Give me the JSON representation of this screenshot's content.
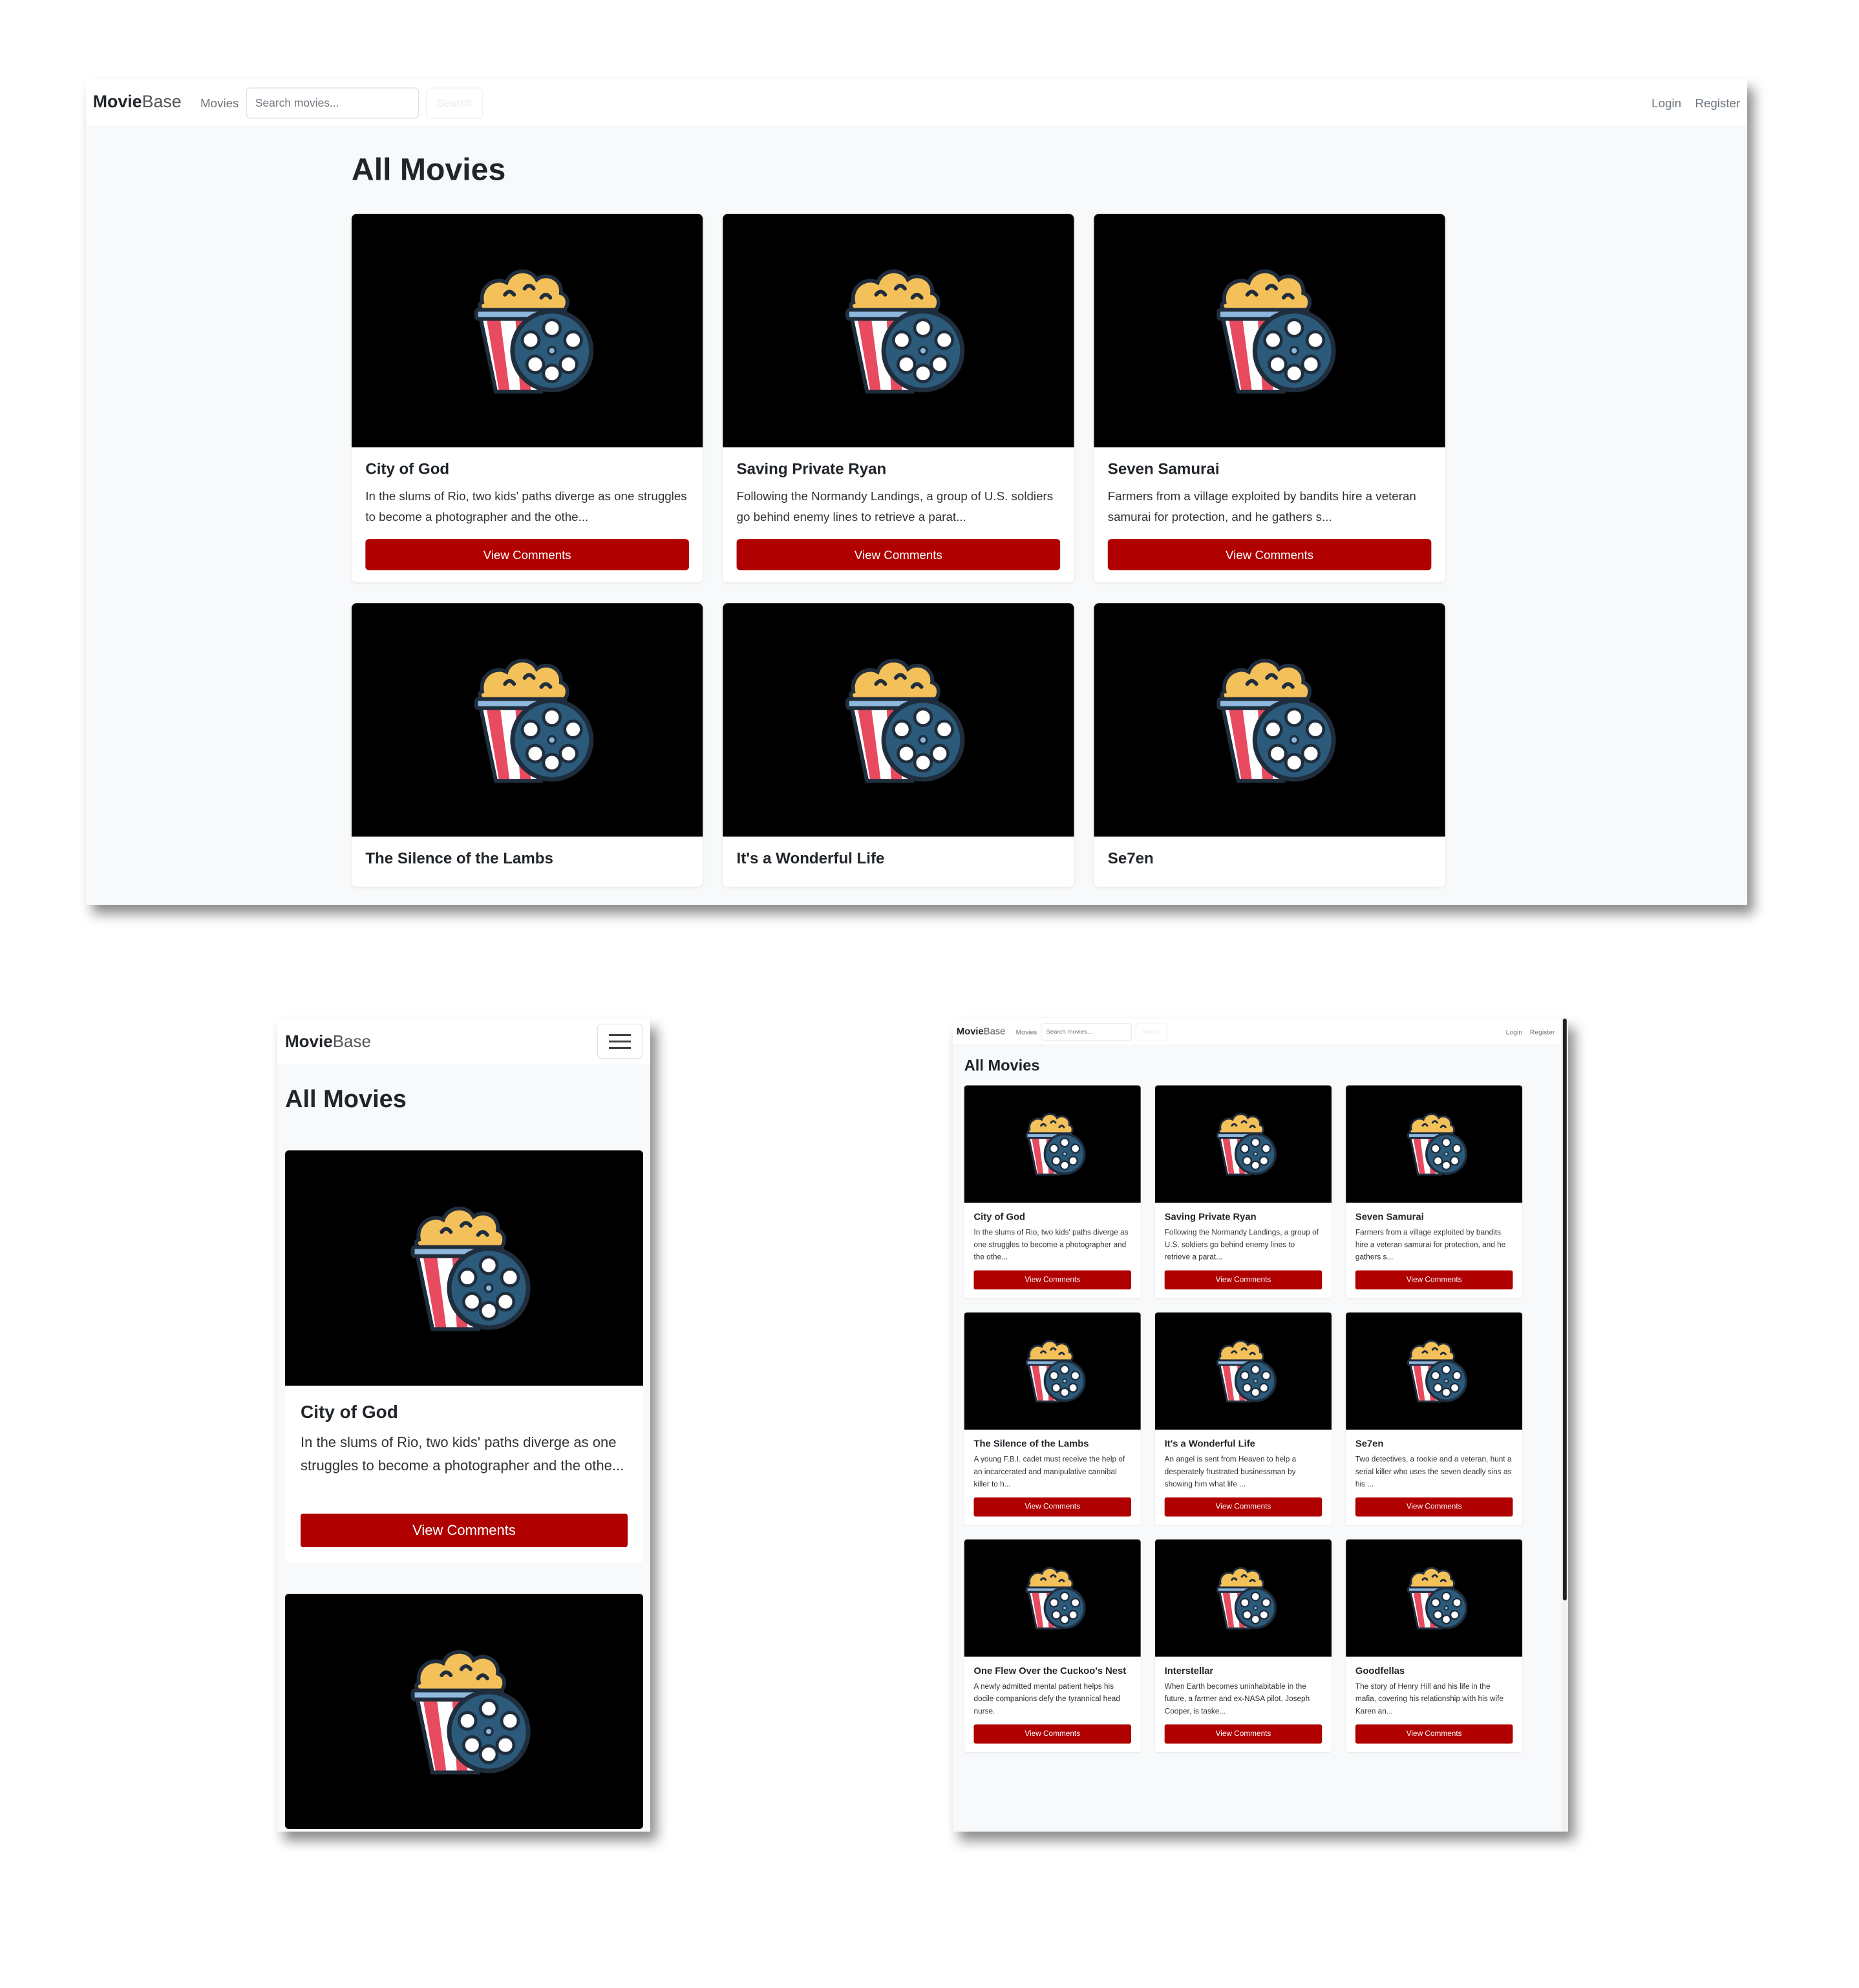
{
  "brand": {
    "bold": "Movie",
    "light": "Base"
  },
  "nav": {
    "movies": "Movies",
    "search_placeholder": "Search movies...",
    "search_button": "Search",
    "login": "Login",
    "register": "Register"
  },
  "page_title": "All Movies",
  "button_label": "View Comments",
  "movies": [
    {
      "title": "City of God",
      "desc_wide": "In the slums of Rio, two kids' paths diverge as one struggles to become a photographer and the othe...",
      "desc_medium": "In the slums of Rio, two kids' paths diverge as one struggles to become a photographer and the othe..."
    },
    {
      "title": "Saving Private Ryan",
      "desc_wide": "Following the Normandy Landings, a group of U.S. soldiers go behind enemy lines to retrieve a parat...",
      "desc_medium": "Following the Normandy Landings, a group of U.S. soldiers go behind enemy lines to retrieve a parat..."
    },
    {
      "title": "Seven Samurai",
      "desc_wide": "Farmers from a village exploited by bandits hire a veteran samurai for protection, and he gathers s...",
      "desc_medium": "Farmers from a village exploited by bandits hire a veteran samurai for protection, and he gathers s..."
    },
    {
      "title": "The Silence of the Lambs",
      "desc_medium": "A young F.B.I. cadet must receive the help of an incarcerated and manipulative cannibal killer to h..."
    },
    {
      "title": "It's a Wonderful Life",
      "desc_medium": "An angel is sent from Heaven to help a desperately frustrated businessman by showing him what life ..."
    },
    {
      "title": "Se7en",
      "desc_medium": "Two detectives, a rookie and a veteran, hunt a serial killer who uses the seven deadly sins as his ..."
    },
    {
      "title": "One Flew Over the Cuckoo's Nest",
      "desc_medium": "A newly admitted mental patient helps his docile companions defy the tyrannical head nurse."
    },
    {
      "title": "Interstellar",
      "desc_medium": "When Earth becomes uninhabitable in the future, a farmer and ex-NASA pilot, Joseph Cooper, is taske..."
    },
    {
      "title": "Goodfellas",
      "desc_medium": "The story of Henry Hill and his life in the mafia, covering his relationship with his wife Karen an..."
    }
  ],
  "icons": {
    "poster": "popcorn-film-reel-icon",
    "menu": "hamburger-menu-icon"
  },
  "colors": {
    "button": "#b00000",
    "page_bg": "#f8f9fa",
    "poster_bg": "#000000"
  }
}
